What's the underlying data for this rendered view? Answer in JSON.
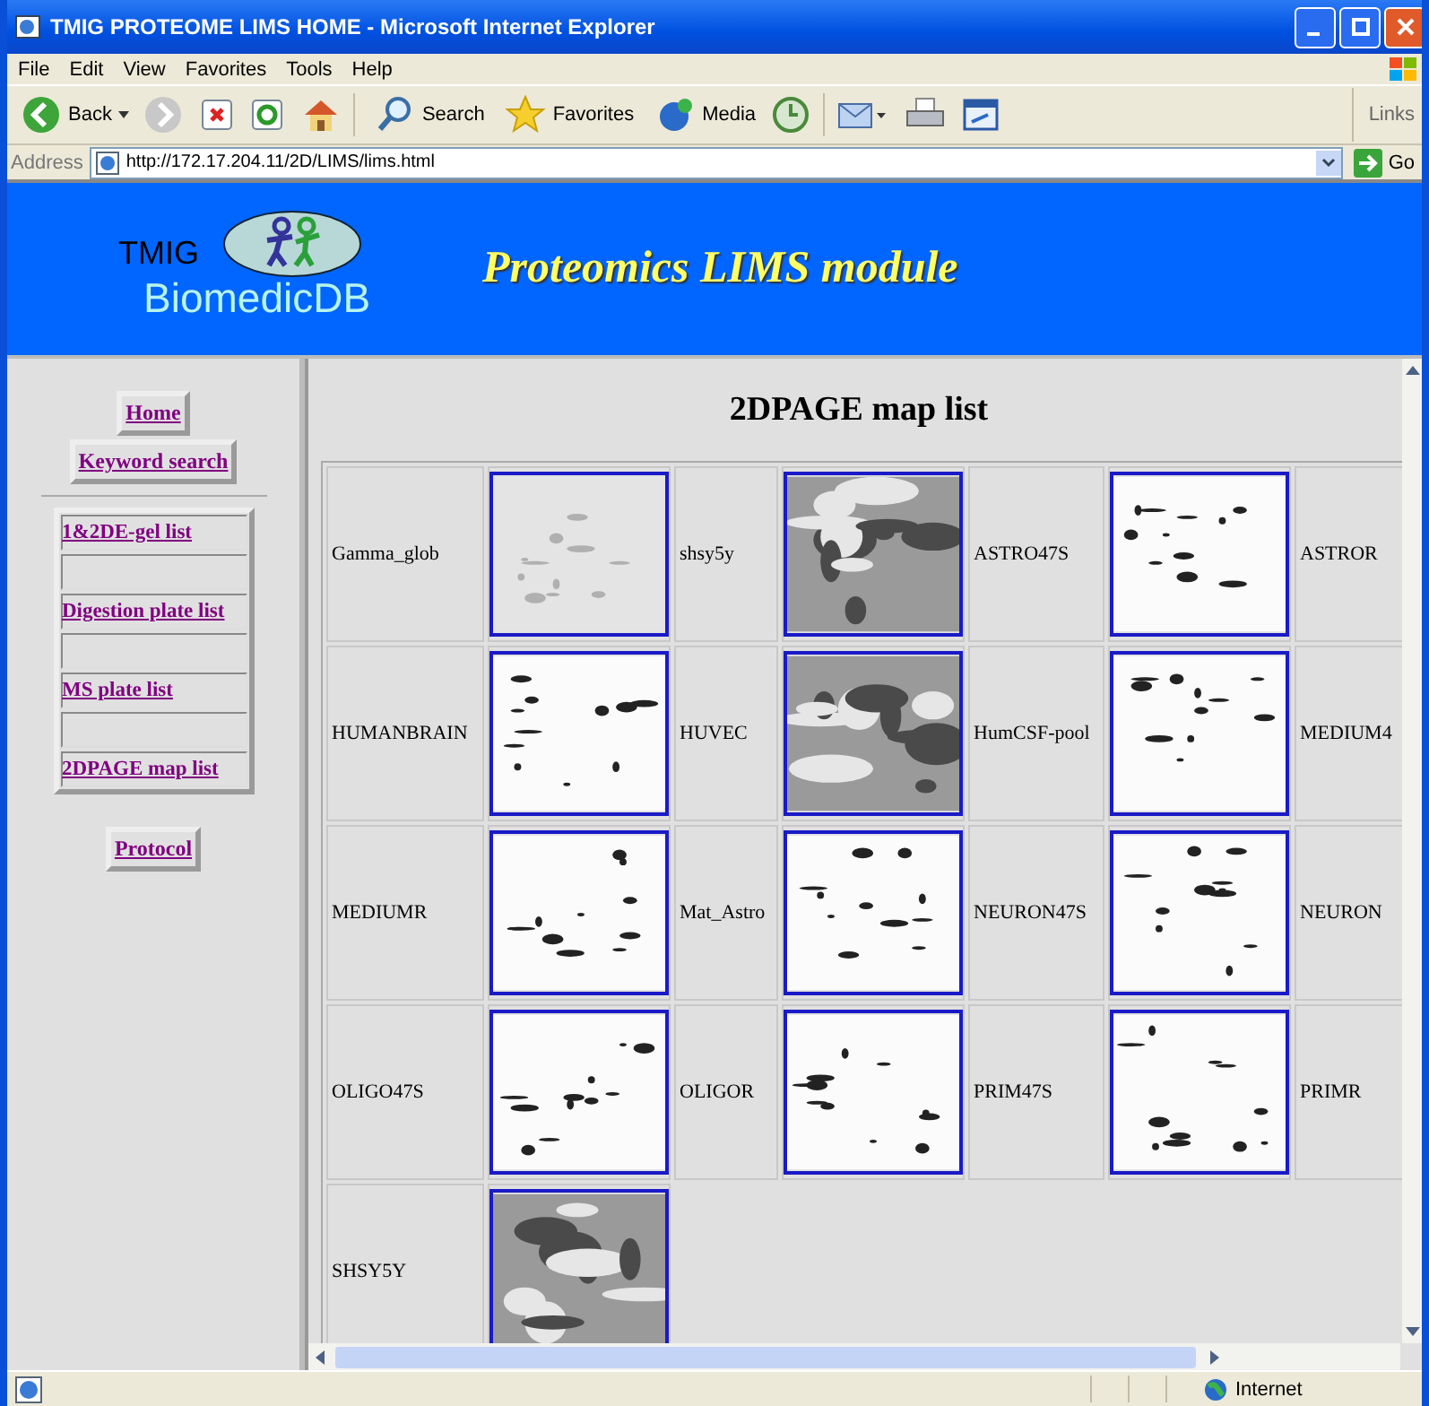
{
  "window": {
    "title": "TMIG PROTEOME LIMS HOME - Microsoft Internet Explorer"
  },
  "menu": [
    "File",
    "Edit",
    "View",
    "Favorites",
    "Tools",
    "Help"
  ],
  "toolbar": {
    "back": "Back",
    "search": "Search",
    "favorites": "Favorites",
    "media": "Media",
    "links": "Links"
  },
  "address": {
    "label": "Address",
    "url": "http://172.17.204.11/2D/LIMS/lims.html",
    "go": "Go"
  },
  "header": {
    "logo_top": "TMIG",
    "logo_bottom": "BiomedicDB",
    "title": "Proteomics LIMS module"
  },
  "nav": {
    "top_links": [
      "Home",
      "Keyword search"
    ],
    "list_links": [
      "1&2DE-gel list",
      "Digestion plate list",
      "MS plate list",
      "2DPAGE map list"
    ],
    "bottom_links": [
      "Protocol"
    ]
  },
  "content": {
    "heading": "2DPAGE map list",
    "maps": [
      {
        "name": "Gamma_glob",
        "kind": "picture"
      },
      {
        "name": "shsy5y",
        "kind": "picture"
      },
      {
        "name": "ASTRO47S",
        "kind": "picture"
      },
      {
        "name": "ASTROR"
      },
      {
        "name": "HUMANBRAIN",
        "kind": "picture"
      },
      {
        "name": "HUVEC",
        "kind": "picture"
      },
      {
        "name": "HumCSF-pool",
        "kind": "picture"
      },
      {
        "name": "MEDIUM4"
      },
      {
        "name": "MEDIUMR",
        "kind": "picture"
      },
      {
        "name": "Mat_Astro",
        "kind": "picture"
      },
      {
        "name": "NEURON47S",
        "kind": "picture"
      },
      {
        "name": "NEURON"
      },
      {
        "name": "OLIGO47S",
        "kind": "picture"
      },
      {
        "name": "OLIGOR",
        "kind": "picture"
      },
      {
        "name": "PRIM47S",
        "kind": "picture"
      },
      {
        "name": "PRIMR"
      },
      {
        "name": "SHSY5Y",
        "kind": "picture"
      }
    ]
  },
  "status_bar": {
    "zone": "Internet"
  }
}
